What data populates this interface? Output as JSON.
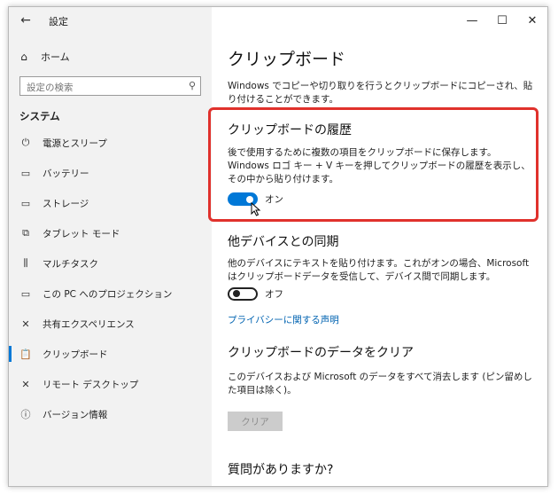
{
  "window": {
    "app_title": "設定",
    "controls": {
      "minimize": "—",
      "maximize": "☐",
      "close": "✕"
    }
  },
  "sidebar": {
    "home_label": "ホーム",
    "search_placeholder": "設定の検索",
    "section_title": "システム",
    "items": [
      {
        "label": "電源とスリープ",
        "icon": "power-icon",
        "glyph": "⏻"
      },
      {
        "label": "バッテリー",
        "icon": "battery-icon",
        "glyph": "▭"
      },
      {
        "label": "ストレージ",
        "icon": "storage-icon",
        "glyph": "▭"
      },
      {
        "label": "タブレット モード",
        "icon": "tablet-mode-icon",
        "glyph": "⧉"
      },
      {
        "label": "マルチタスク",
        "icon": "multitasking-icon",
        "glyph": "⫼"
      },
      {
        "label": "この PC へのプロジェクション",
        "icon": "projection-icon",
        "glyph": "▭"
      },
      {
        "label": "共有エクスペリエンス",
        "icon": "shared-experiences-icon",
        "glyph": "✕"
      },
      {
        "label": "クリップボード",
        "icon": "clipboard-icon",
        "glyph": "📋",
        "active": true
      },
      {
        "label": "リモート デスクトップ",
        "icon": "remote-desktop-icon",
        "glyph": "✕"
      },
      {
        "label": "バージョン情報",
        "icon": "about-icon",
        "glyph": "ⓘ"
      }
    ]
  },
  "main": {
    "page_title": "クリップボード",
    "intro": "Windows でコピーや切り取りを行うとクリップボードにコピーされ、貼り付けることができます。",
    "history": {
      "title": "クリップボードの履歴",
      "description": "後で使用するために複数の項目をクリップボードに保存します。Windows ロゴ キー + V キーを押してクリップボードの履歴を表示し、その中から貼り付けます。",
      "toggle_label": "オン"
    },
    "sync": {
      "title": "他デバイスとの同期",
      "description": "他のデバイスにテキストを貼り付けます。これがオンの場合、Microsoft はクリップボードデータを受信して、デバイス間で同期します。",
      "toggle_label": "オフ",
      "privacy_link": "プライバシーに関する声明"
    },
    "clear": {
      "title": "クリップボードのデータをクリア",
      "description": "このデバイスおよび Microsoft のデータをすべて消去します (ピン留めした項目は除く)。",
      "button_label": "クリア"
    },
    "questions_title": "質問がありますか?"
  },
  "colors": {
    "accent": "#0078d7",
    "highlight": "#e0312c",
    "link": "#0063b1"
  }
}
